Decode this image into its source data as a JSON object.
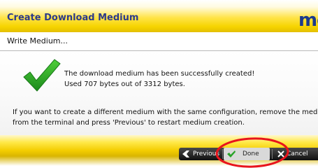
{
  "window": {
    "title": "Create Download Medium",
    "logo_text": "me"
  },
  "step": {
    "title": "Write Medium..."
  },
  "status": {
    "icon": "checkmark-icon",
    "line1": "The download medium has been successfully created!",
    "line2": "Used 707 bytes out of 3312 bytes."
  },
  "instructions": {
    "line1": "If you want to create a different medium with the same configuration, remove the medium",
    "line2": "from the terminal and press 'Previous' to restart medium creation."
  },
  "buttons": {
    "previous": "Previous",
    "done": "Done",
    "cancel": "Cancel"
  },
  "colors": {
    "accent_yellow": "#f6d400",
    "title_blue": "#2c3a8a",
    "check_green": "#2fa82c",
    "annotation_red": "#e8141c"
  }
}
